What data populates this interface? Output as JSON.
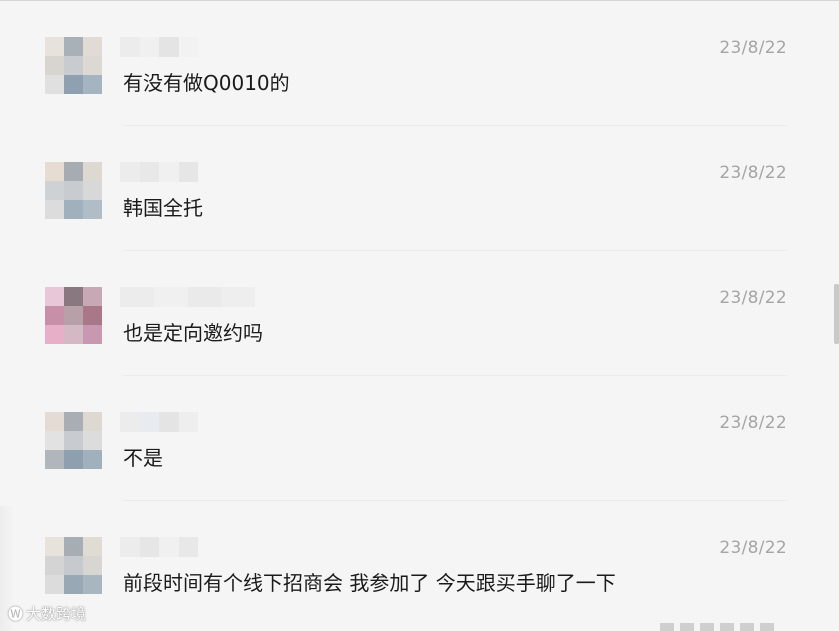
{
  "messages": [
    {
      "date": "23/8/22",
      "text": "有没有做Q0010的",
      "avatar_colors": [
        "#e8e2dc",
        "#a8b0b8",
        "#e0dcd5",
        "#d8d4d0",
        "#c8ccd0",
        "#dcd8d4",
        "#e0e0e0",
        "#8fa0b0",
        "#a4b4c0"
      ],
      "name_colors": [
        "#ececec",
        "#f0f0f0",
        "#e4e4e4",
        "#f2f2f2"
      ]
    },
    {
      "date": "23/8/22",
      "text": "韩国全托",
      "avatar_colors": [
        "#e6dcd2",
        "#a6acb2",
        "#ddd8d0",
        "#cfd2d4",
        "#c8ccd0",
        "#d8d8d8",
        "#dcdcdc",
        "#a0b0bc",
        "#b0bcc6"
      ],
      "name_colors": [
        "#ececec",
        "#e8e8e8",
        "#f0f0f0",
        "#e6e6e6"
      ]
    },
    {
      "date": "23/8/22",
      "text": "也是定向邀约吗",
      "avatar_colors": [
        "#e8c8d8",
        "#8a7880",
        "#c8a8b4",
        "#c890a8",
        "#b8a0a8",
        "#a87888",
        "#e8b0c8",
        "#d4b8c4",
        "#c898b0"
      ],
      "name_colors": [
        "#ececec",
        "#f0f0f0",
        "#eaeaea",
        "#eeeeee"
      ]
    },
    {
      "date": "23/8/22",
      "text": "不是",
      "avatar_colors": [
        "#e4dcd4",
        "#a8aeb4",
        "#ddd8d0",
        "#e2e2e2",
        "#c8ccd0",
        "#dcdcdc",
        "#b0b6bc",
        "#8ea0b0",
        "#a0b0bc"
      ],
      "name_colors": [
        "#ececec",
        "#e8ecf0",
        "#e4e4e4",
        "#eeeeee"
      ]
    },
    {
      "date": "23/8/22",
      "text": "前段时间有个线下招商会 我参加了 今天跟买手聊了一下",
      "avatar_colors": [
        "#e8e2dc",
        "#a6aeb4",
        "#e0dcd4",
        "#d4d4d4",
        "#c6cace",
        "#d8d6d2",
        "#dcdcdc",
        "#98a8b4",
        "#a8b6c0"
      ],
      "name_colors": [
        "#ececec",
        "#e6e6e6",
        "#f0f0f0",
        "#e8e8e8"
      ]
    }
  ],
  "watermark": {
    "logo": "🅦",
    "text": "大数跨境"
  }
}
